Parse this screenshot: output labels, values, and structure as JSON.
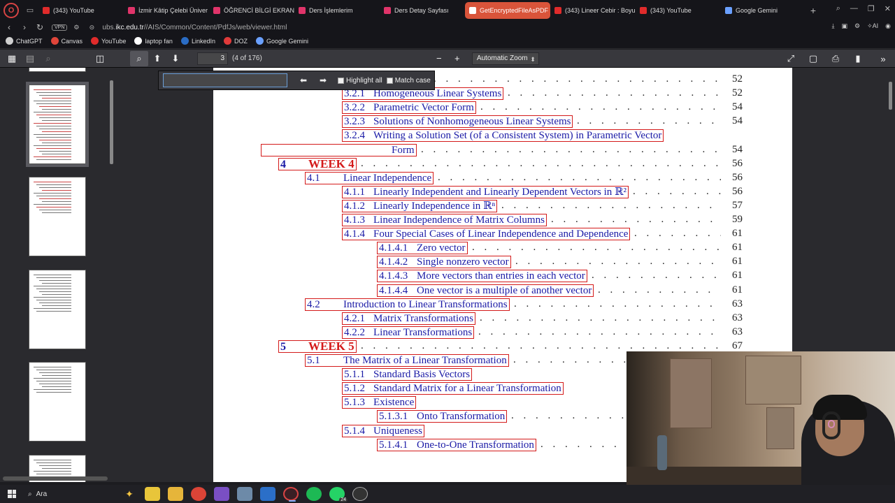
{
  "browser": {
    "tabs": [
      {
        "label": "(343) YouTube",
        "color": "#e02b2b",
        "active": false
      },
      {
        "label": "İzmir Kâtip Çelebi Üniver",
        "color": "#e0346a",
        "active": false
      },
      {
        "label": "ÖĞRENCİ BİLGİ EKRANI*",
        "color": "#e0346a",
        "active": false
      },
      {
        "label": "Ders İşlemlerim",
        "color": "#e0346a",
        "active": false
      },
      {
        "label": "Ders Detay Sayfası",
        "color": "#e0346a",
        "active": false
      },
      {
        "label": "GetEncryptedFileAsPDF",
        "color": "#ffffff",
        "active": true
      },
      {
        "label": "(343) Lineer Cebir : Boyu",
        "color": "#e02b2b",
        "active": false
      },
      {
        "label": "(343) YouTube",
        "color": "#e02b2b",
        "active": false
      },
      {
        "label": "Google Gemini",
        "color": "#6aa0ff",
        "active": false
      }
    ],
    "new_tab": "+",
    "vpn": "VPN",
    "url_prefix": "ubs.",
    "url_domain": "ikc.edu.tr",
    "url_path": "//AIS/Common/Content/PdfJs/web/viewer.html",
    "ai_label": "AI",
    "bookmarks": [
      {
        "label": "ChatGPT",
        "color": "#cfcfcf"
      },
      {
        "label": "Canvas",
        "color": "#e0453a"
      },
      {
        "label": "YouTube",
        "color": "#e02b2b"
      },
      {
        "label": "laptop fan",
        "color": "#ffffff"
      },
      {
        "label": "LinkedIn",
        "color": "#2a6cc4"
      },
      {
        "label": "DOZ",
        "color": "#e03a3a"
      },
      {
        "label": "Google Gemini",
        "color": "#6aa0ff"
      }
    ]
  },
  "pdf": {
    "page_number": "3",
    "page_count": "(4 of 176)",
    "zoom": "Automatic Zoom",
    "find": {
      "placeholder": "",
      "highlight_all": "Highlight all",
      "match_case": "Match case"
    },
    "toc": [
      {
        "num": "",
        "title": "inear Systems",
        "page": "52",
        "level": 1,
        "partial": true
      },
      {
        "num": "3.2.1",
        "title": "Homogeneous Linear Systems",
        "page": "52",
        "level": 2
      },
      {
        "num": "3.2.2",
        "title": "Parametric Vector Form",
        "page": "54",
        "level": 2
      },
      {
        "num": "3.2.3",
        "title": "Solutions of Nonhomogeneous Linear Systems",
        "page": "54",
        "level": 2
      },
      {
        "num": "3.2.4",
        "title": "Writing a Solution Set (of a Consistent System) in Parametric Vector",
        "page": "",
        "level": 2
      },
      {
        "num": "",
        "title": "Form",
        "page": "54",
        "level": 9
      },
      {
        "num": "4",
        "title": "WEEK 4",
        "page": "56",
        "level": 0
      },
      {
        "num": "4.1",
        "title": "Linear Independence",
        "page": "56",
        "level": 1
      },
      {
        "num": "4.1.1",
        "title": "Linearly Independent and Linearly Dependent Vectors in ℝ²",
        "page": "56",
        "level": 2
      },
      {
        "num": "4.1.2",
        "title": "Linearly Independence in ℝⁿ",
        "page": "57",
        "level": 2
      },
      {
        "num": "4.1.3",
        "title": "Linear Independence of Matrix Columns",
        "page": "59",
        "level": 2
      },
      {
        "num": "4.1.4",
        "title": "Four Special Cases of Linear Independence and Dependence",
        "page": "61",
        "level": 2
      },
      {
        "num": "4.1.4.1",
        "title": "Zero vector",
        "page": "61",
        "level": 3
      },
      {
        "num": "4.1.4.2",
        "title": "Single nonzero vector",
        "page": "61",
        "level": 3
      },
      {
        "num": "4.1.4.3",
        "title": "More vectors than entries in each vector",
        "page": "61",
        "level": 3
      },
      {
        "num": "4.1.4.4",
        "title": "One vector is a multiple of another vector",
        "page": "61",
        "level": 3
      },
      {
        "num": "4.2",
        "title": "Introduction to Linear Transformations",
        "page": "63",
        "level": 1
      },
      {
        "num": "4.2.1",
        "title": "Matrix Transformations",
        "page": "63",
        "level": 2
      },
      {
        "num": "4.2.2",
        "title": "Linear Transformations",
        "page": "63",
        "level": 2
      },
      {
        "num": "5",
        "title": "WEEK 5",
        "page": "67",
        "level": 0
      },
      {
        "num": "5.1",
        "title": "The Matrix of a Linear Transformation",
        "page": "",
        "level": 1
      },
      {
        "num": "5.1.1",
        "title": "Standard Basis Vectors",
        "page": "",
        "level": 2
      },
      {
        "num": "5.1.2",
        "title": "Standard Matrix for a Linear Transformation",
        "page": "",
        "level": 2
      },
      {
        "num": "5.1.3",
        "title": "Existence",
        "page": "",
        "level": 2
      },
      {
        "num": "5.1.3.1",
        "title": "Onto Transformation",
        "page": "",
        "level": 3
      },
      {
        "num": "5.1.4",
        "title": "Uniqueness",
        "page": "",
        "level": 2
      },
      {
        "num": "5.1.4.1",
        "title": "One-to-One Transformation",
        "page": "",
        "level": 3
      }
    ]
  },
  "taskbar": {
    "search_label": "Ara",
    "whatsapp_badge": "24"
  }
}
